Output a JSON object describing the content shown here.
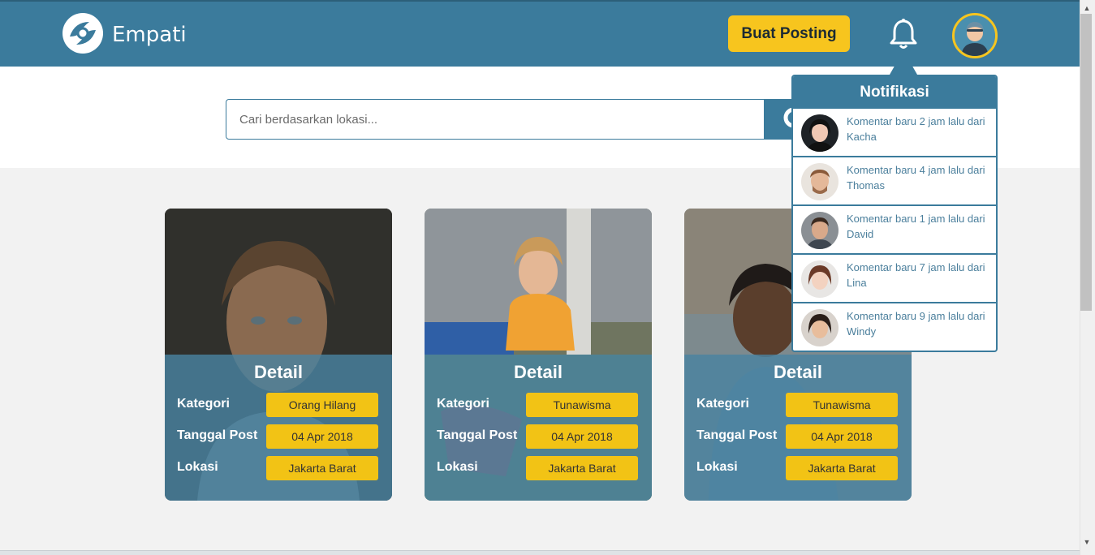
{
  "header": {
    "brand": "Empati",
    "post_button": "Buat Posting",
    "colors": {
      "primary": "#3b7b9c",
      "accent": "#f7c51e"
    }
  },
  "search": {
    "placeholder": "Cari berdasarkan lokasi..."
  },
  "cards": [
    {
      "title": "Detail",
      "labels": {
        "category": "Kategori",
        "date": "Tanggal Post",
        "location": "Lokasi"
      },
      "category": "Orang Hilang",
      "date": "04 Apr 2018",
      "location": "Jakarta Barat"
    },
    {
      "title": "Detail",
      "labels": {
        "category": "Kategori",
        "date": "Tanggal Post",
        "location": "Lokasi"
      },
      "category": "Tunawisma",
      "date": "04 Apr 2018",
      "location": "Jakarta Barat"
    },
    {
      "title": "Detail",
      "labels": {
        "category": "Kategori",
        "date": "Tanggal Post",
        "location": "Lokasi"
      },
      "category": "Tunawisma",
      "date": "04 Apr 2018",
      "location": "Jakarta Barat"
    }
  ],
  "notifications": {
    "title": "Notifikasi",
    "items": [
      {
        "text": "Komentar baru 2 jam lalu dari Kacha"
      },
      {
        "text": "Komentar baru 4 jam lalu dari Thomas"
      },
      {
        "text": "Komentar baru 1 jam lalu dari David"
      },
      {
        "text": "Komentar baru 7 jam lalu dari Lina"
      },
      {
        "text": "Komentar baru 9 jam lalu dari Windy"
      }
    ]
  },
  "icons": {
    "logo": "hands-heart-logo-icon",
    "bell": "bell-icon",
    "search": "search-icon",
    "avatar": "user-avatar-icon"
  }
}
